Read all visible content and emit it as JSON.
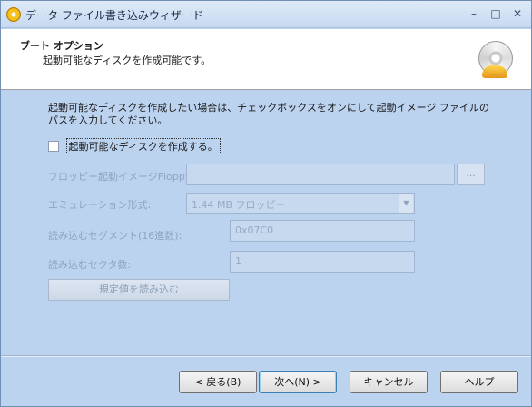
{
  "window": {
    "title": "データ ファイル書き込みウィザード",
    "minimize": "–",
    "maximize": "□",
    "close": "✕"
  },
  "header": {
    "title": "ブート オプション",
    "subtitle": "起動可能なディスクを作成可能です。"
  },
  "content": {
    "instructions": "起動可能なディスクを作成したい場合は、チェックボックスをオンにして起動イメージ ファイルのパスを入力してください。",
    "bootable_checkbox": {
      "label": "起動可能なディスクを作成する。",
      "checked": false
    },
    "floppy_image": {
      "label": "フロッピー起動イメージFloppy",
      "value": "",
      "browse_label": "..."
    },
    "emulation": {
      "label": "エミュレーション形式:",
      "selected": "1.44 MB フロッピー"
    },
    "load_segment": {
      "label": "読み込むセグメント(16進数):",
      "value": "0x07C0"
    },
    "sector_count": {
      "label": "読み込むセクタ数:",
      "value": "1"
    },
    "load_defaults_label": "規定値を読み込む"
  },
  "footer": {
    "back": "< 戻る(B)",
    "next": "次へ(N) >",
    "cancel": "キャンセル",
    "help": "ヘルプ"
  }
}
